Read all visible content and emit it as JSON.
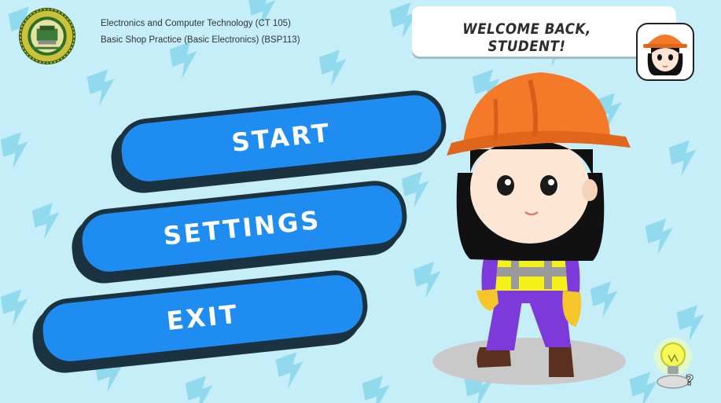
{
  "header": {
    "course_line_1": "Electronics and Computer Technology (CT 105)",
    "course_line_2": "Basic Shop Practice (Basic Electronics) (BSP113)"
  },
  "welcome": {
    "text": "WELCOME BACK, STUDENT!"
  },
  "menu": {
    "start_label": "START",
    "settings_label": "SETTINGS",
    "exit_label": "EXIT"
  },
  "colors": {
    "background": "#c6eef8",
    "pattern": "#7fd3ea",
    "button_fill": "#1e8cf0",
    "button_outline": "#1b3340",
    "helmet": "#f47a2a",
    "vest": "#f2f21a"
  },
  "icons": {
    "logo": "school-seal-icon",
    "avatar": "student-avatar-icon",
    "hint": "lightbulb-hint-icon",
    "pattern": "lightning-bolt-icon"
  }
}
